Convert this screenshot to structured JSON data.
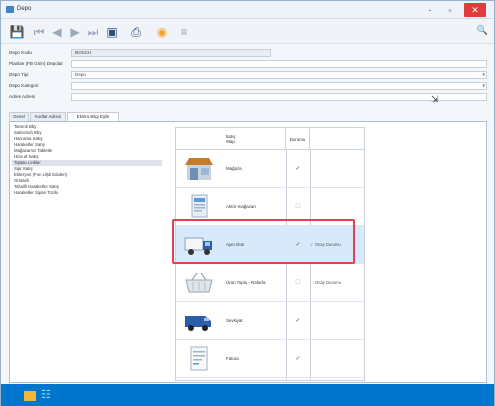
{
  "window": {
    "title": "Depo",
    "controls": [
      "-",
      "▫",
      "✕"
    ]
  },
  "toolbar": {
    "items": [
      {
        "name": "save-icon",
        "glyph": "💾"
      },
      {
        "name": "first-icon",
        "glyph": "⏮"
      },
      {
        "name": "previous-icon",
        "glyph": "◀"
      },
      {
        "name": "next-icon",
        "glyph": "▶"
      },
      {
        "name": "last-icon",
        "glyph": "⏭"
      },
      {
        "name": "document-icon",
        "glyph": "▣"
      },
      {
        "name": "print-icon",
        "glyph": "⎙"
      },
      {
        "name": "bulb-icon",
        "glyph": "◉"
      },
      {
        "name": "list-icon",
        "glyph": "≡"
      }
    ],
    "search_glyph": "🔍"
  },
  "form": {
    "depo_kodu_label": "Depo Kodu",
    "depo_kodu_value": "BOSCH",
    "depo_adi_label": "Planlan (FB Girin) Depolar",
    "depo_tipi_label": "Depo Tipi",
    "depo_tipi_value": "Depo",
    "depo_kategori_label": "Depo Kategori",
    "adres_label": "Adres Adresi"
  },
  "tabs": [
    {
      "label": "Genel",
      "active": false
    },
    {
      "label": "Kodlar Adresi",
      "active": false
    },
    {
      "label": "Ekstra Bilgi Eşlik",
      "active": true
    }
  ],
  "left_list": [
    {
      "label": "Tanımlı Bby",
      "selected": false
    },
    {
      "label": "Saticimuh Bby",
      "selected": false
    },
    {
      "label": "Harcama Satış",
      "selected": false
    },
    {
      "label": "Haraketler Satış",
      "selected": false
    },
    {
      "label": "Mağazamız Tabletle",
      "selected": false
    },
    {
      "label": "Hiza of Satış",
      "selected": false
    },
    {
      "label": "Toptan Linkler",
      "selected": true
    },
    {
      "label": "Sipr Satış",
      "selected": false
    },
    {
      "label": "Eklezyon (Fon Ulşk Eduleri)",
      "selected": false
    },
    {
      "label": "Omtash",
      "selected": false
    },
    {
      "label": "Tahsilli Haraketler Satış",
      "selected": false
    },
    {
      "label": "Haraketler Siparı Tozilo",
      "selected": false
    }
  ],
  "grid": {
    "header_type": "Satış\nMap",
    "header_active": "Durumu",
    "rows": [
      {
        "name": "Mağaza",
        "icon": "store-icon",
        "checked": true,
        "extra": "",
        "selected": false
      },
      {
        "name": "Aktör-mağazan",
        "icon": "document-icon",
        "checked": false,
        "extra": "",
        "selected": false
      },
      {
        "name": "Aynı Gün",
        "icon": "truck-icon",
        "checked": true,
        "extra": "Onay Durumu",
        "extra_checked": true,
        "selected": true
      },
      {
        "name": "Ürün Toplu - Rafarfa",
        "icon": "basket-icon",
        "checked": false,
        "extra": "Onay Durumu",
        "extra_checked": false,
        "selected": false
      },
      {
        "name": "Sevkiyat",
        "icon": "van-icon",
        "checked": true,
        "extra": "",
        "selected": false
      },
      {
        "name": "Fatura",
        "icon": "invoice-icon",
        "checked": true,
        "extra": "",
        "selected": false
      }
    ]
  }
}
